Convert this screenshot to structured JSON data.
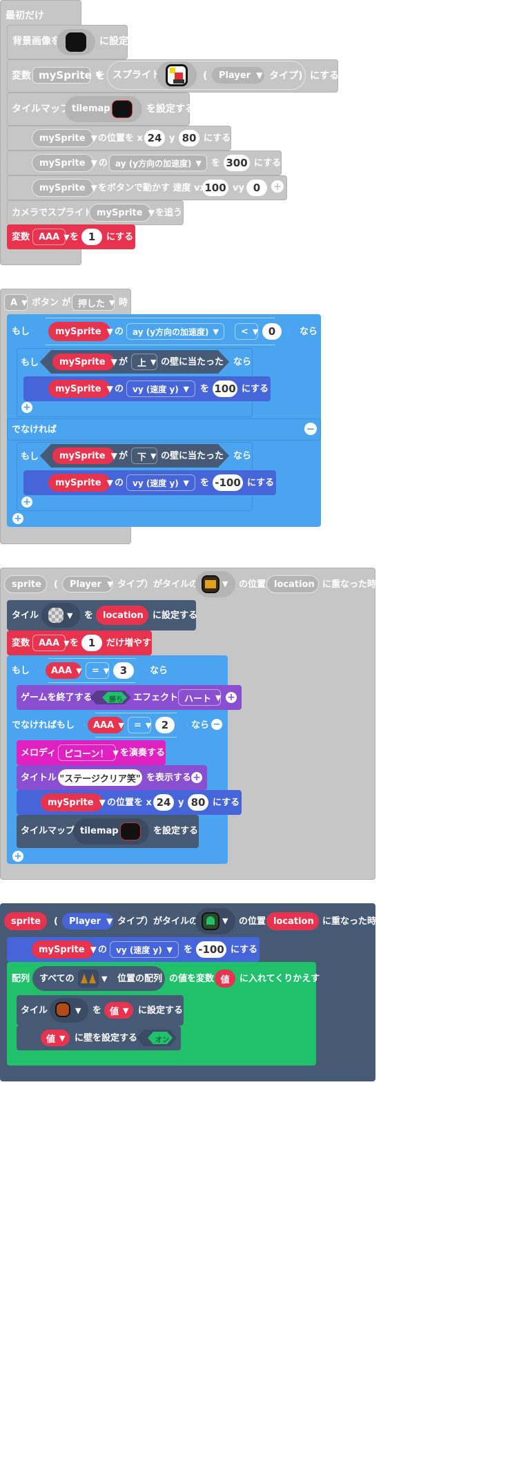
{
  "group1": {
    "hat": "最初だけ",
    "bg_label_a": "背景画像を",
    "bg_label_b": "に設定",
    "var_label": "変数",
    "var_name": "mySprite",
    "wo": "を",
    "sprite_label": "スプライト",
    "paren_open": "(",
    "kind": "Player",
    "kind_suffix": "タイプ)",
    "suru": "にする",
    "tilemap_label": "タイルマップ",
    "tilemap_value": "tilemap",
    "tilemap_set": "を設定する",
    "pos_sprite": "mySprite",
    "pos_label": "の位置を x",
    "pos_x": "24",
    "pos_y_label": "y",
    "pos_y": "80",
    "pos_suru": "にする",
    "ay_sprite": "mySprite",
    "no": "の",
    "ay_prop": "ay (y方向の加速度)",
    "ay_wo": "を",
    "ay_value": "300",
    "ay_suru": "にする",
    "move_sprite": "mySprite",
    "move_label": "をボタンで動かす 速度 vx",
    "move_vx": "100",
    "move_vy_label": "vy",
    "move_vy": "0",
    "camera_label": "カメラでスプライト",
    "camera_sprite": "mySprite",
    "camera_follow": "を追う",
    "setvar_label": "変数",
    "setvar_name": "AAA",
    "setvar_wo": "を",
    "setvar_value": "1",
    "setvar_suru": "にする"
  },
  "group2": {
    "button": "A",
    "button_label": "ボタン が",
    "action": "押した",
    "when": "時",
    "if1": "もし",
    "if1_sprite": "mySprite",
    "if1_no": "の",
    "if1_prop": "ay (y方向の加速度)",
    "if1_op": "<",
    "if1_value": "0",
    "if1_then": "なら",
    "if2": "もし",
    "if2_sprite": "mySprite",
    "if2_ga": "が",
    "if2_dir": "上",
    "if2_wall": "の壁に当たった",
    "if2_then": "なら",
    "set1_sprite": "mySprite",
    "set1_no": "の",
    "set1_prop": "vy (速度 y)",
    "set1_wo": "を",
    "set1_value": "100",
    "set1_suru": "にする",
    "else": "でなければ",
    "if3": "もし",
    "if3_sprite": "mySprite",
    "if3_ga": "が",
    "if3_dir": "下",
    "if3_wall": "の壁に当たった",
    "if3_then": "なら",
    "set2_sprite": "mySprite",
    "set2_no": "の",
    "set2_prop": "vy (速度 y)",
    "set2_wo": "を",
    "set2_value": "-100",
    "set2_suru": "にする"
  },
  "group3": {
    "hat_sprite": "sprite",
    "paren": "(",
    "kind": "Player",
    "kind_tile": "タイプ）がタイルの",
    "pos_label": "の位置を x",
    "loc": "location",
    "overlap": "に重なった時",
    "tile_label": "タイル",
    "tile_wo": "を",
    "tile_loc": "location",
    "tile_set": "に設定する",
    "inc_label": "変数",
    "inc_var": "AAA",
    "inc_wo": "を",
    "inc_value": "1",
    "inc_suffix": "だけ増やす",
    "if_label": "もし",
    "if_var": "AAA",
    "if_op": "=",
    "if_value": "3",
    "if_then": "なら",
    "gameover_label": "ゲームを終了する",
    "gameover_win": "勝ち",
    "effect_label": "エフェクト",
    "effect_value": "ハート",
    "elseif_label": "でなければもし",
    "elseif_var": "AAA",
    "elseif_op": "=",
    "elseif_value": "2",
    "elseif_then": "なら",
    "melody_label": "メロディ",
    "melody_value": "ピコーン！",
    "melody_play": "を演奏する",
    "title_label": "タイトル",
    "title_value": "\"ステージクリア笑\"",
    "title_show": "を表示する",
    "pos_sprite": "mySprite",
    "pos_x": "24",
    "pos_y_label": "y",
    "pos_y": "80",
    "pos_suru": "にする",
    "tilemap_label": "タイルマップ",
    "tilemap_value": "tilemap",
    "tilemap_set": "を設定する"
  },
  "group4": {
    "hat_sprite": "sprite",
    "paren": "(",
    "kind": "Player",
    "kind_tile": "タイプ）がタイルの",
    "pos_label": "の位置",
    "loc": "location",
    "overlap": "に重なった時",
    "vy_sprite": "mySprite",
    "vy_no": "の",
    "vy_prop": "vy (速度 y)",
    "vy_wo": "を",
    "vy_value": "-100",
    "vy_suru": "にする",
    "array_label": "配列",
    "array_all": "すべての",
    "array_pos": "位置の配列",
    "array_val": "の値を変数",
    "array_var": "値",
    "array_loop": "に入れてくりかえす",
    "tile_label": "タイル",
    "tile_wo": "を",
    "tile_var": "値",
    "tile_set": "に設定する",
    "wall_var": "値",
    "wall_label": "に壁を設定する",
    "wall_on": "オン"
  },
  "colors": {
    "gray_block": "#c8c8c8",
    "gray_pill": "#b4b4b4",
    "blue": "#4aa4f0",
    "red": "#e8334f",
    "slate": "#475a75",
    "purple": "#8a4fd0",
    "magenta": "#e020c0",
    "green": "#21c06a"
  }
}
